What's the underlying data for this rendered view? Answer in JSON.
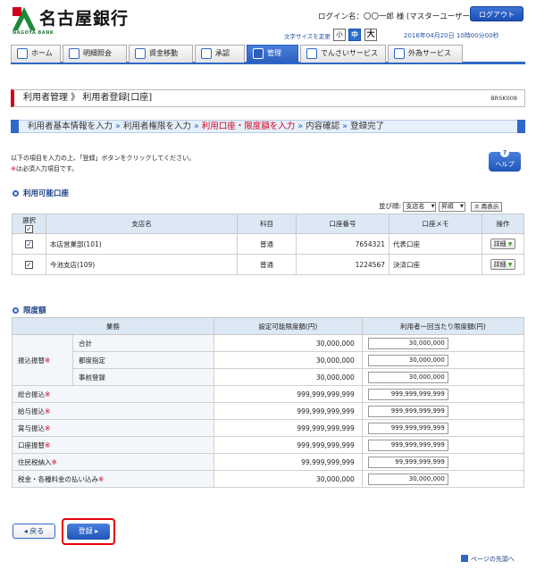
{
  "header": {
    "bank_name": "名古屋銀行",
    "bank_sub": "NAGOYA BANK",
    "login_name": "ログイン名：〇〇一郎 様 (マスターユーザー)",
    "logout_label": "ログアウト",
    "font_size_label": "文字サイズを変更",
    "font_small": "小",
    "font_mid": "中",
    "font_large": "大",
    "datetime": "2016年04月20日 10時00分00秒"
  },
  "nav": {
    "tabs": [
      {
        "label": "ホーム",
        "icon": "home-icon"
      },
      {
        "label": "明細照会",
        "icon": "document-icon"
      },
      {
        "label": "資金移動",
        "icon": "transfer-icon"
      },
      {
        "label": "承認",
        "icon": "check-icon"
      },
      {
        "label": "管理",
        "icon": "admin-icon"
      },
      {
        "label": "でんさいサービス",
        "icon": "densai-icon"
      },
      {
        "label": "外為サービス",
        "icon": "forex-icon"
      }
    ]
  },
  "page": {
    "title": "利用者管理 》 利用者登録[口座]",
    "screen_id": "BRSK008"
  },
  "steps": {
    "s1": "利用者基本情報を入力",
    "s2": "利用者権限を入力",
    "s3": "利用口座・限度額を入力",
    "s4": "内容確認",
    "s5": "登録完了",
    "arrow": "»"
  },
  "instructions": {
    "line1": "以下の項目を入力の上、「登録」ボタンをクリックしてください。",
    "req_mark": "※",
    "line2": "は必須入力項目です。"
  },
  "help_label": "ヘルプ",
  "accounts_section": {
    "title": "利用可能口座",
    "sort_label": "並び順:",
    "sort_field": "支店名",
    "sort_order": "昇順",
    "redisplay": "再表示",
    "headers": {
      "select": "選択",
      "branch": "支店名",
      "type": "科目",
      "number": "口座番号",
      "memo": "口座メモ",
      "action": "操作"
    },
    "rows": [
      {
        "branch": "本店営業部(101)",
        "type": "普通",
        "number": "7654321",
        "memo": "代表口座",
        "detail": "詳細"
      },
      {
        "branch": "今池支店(109)",
        "type": "普通",
        "number": "1224567",
        "memo": "決済口座",
        "detail": "詳細"
      }
    ]
  },
  "limits_section": {
    "title": "限度額",
    "headers": {
      "business": "業務",
      "settable": "設定可能限度額(円)",
      "per_user": "利用者一回当たり限度額(円)"
    },
    "furikomi_group": "振込振替",
    "rows": [
      {
        "label": "合計",
        "settable": "30,000,000",
        "value": "30,000,000"
      },
      {
        "label": "都度指定",
        "settable": "30,000,000",
        "value": "30,000,000"
      },
      {
        "label": "事前登録",
        "settable": "30,000,000",
        "value": "30,000,000"
      },
      {
        "label": "総合振込",
        "settable": "999,999,999,999",
        "value": "999,999,999,999"
      },
      {
        "label": "給与振込",
        "settable": "999,999,999,999",
        "value": "999,999,999,999"
      },
      {
        "label": "賞与振込",
        "settable": "999,999,999,999",
        "value": "999,999,999,999"
      },
      {
        "label": "口座振替",
        "settable": "999,999,999,999",
        "value": "999,999,999,999"
      },
      {
        "label": "住民税納入",
        "settable": "99,999,999,999",
        "value": "99,999,999,999"
      },
      {
        "label": "税金・各種料金の払い込み",
        "settable": "30,000,000",
        "value": "30,000,000"
      }
    ]
  },
  "buttons": {
    "back": "戻る",
    "register": "登録"
  },
  "page_top": "ページの先頭へ",
  "colors": {
    "accent": "#2f68c7",
    "required": "#d0021b",
    "highlight_border": "#e8000b"
  }
}
